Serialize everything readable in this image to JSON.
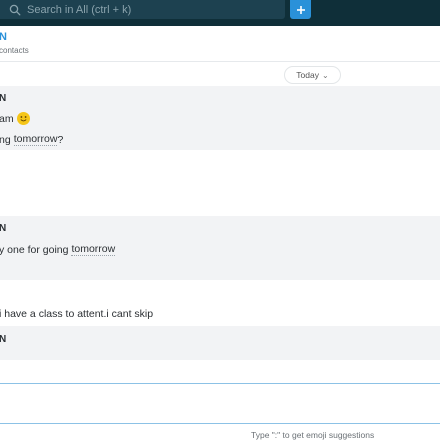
{
  "search": {
    "placeholder": "Search in All (ctrl + k)"
  },
  "toolbar": {
    "add_label": "+"
  },
  "conversation": {
    "name": "N",
    "subtitle": "contacts"
  },
  "day_separator": {
    "label": "Today"
  },
  "messages": [
    {
      "sender": "N",
      "lines": [
        {
          "text": "am",
          "emoji": "smiley"
        },
        {
          "prefix": "ng",
          "link": "tomorrow",
          "suffix": "?"
        }
      ]
    },
    {
      "sender": "N",
      "lines": [
        {
          "prefix": "y one for going",
          "link": "tomorrow"
        }
      ]
    },
    {
      "text": "i have a class to attent.i cant skip"
    },
    {
      "sender": "N"
    }
  ],
  "composer": {
    "hint": "Type \":\" to get emoji suggestions"
  },
  "colors": {
    "accent": "#2a91d9",
    "topbar": "#0f2f39",
    "message_bg": "#f2f3f5"
  },
  "icons": {
    "search": "search-icon",
    "smiley": "smiley-emoji-icon",
    "chevron": "chevron-down-icon"
  }
}
